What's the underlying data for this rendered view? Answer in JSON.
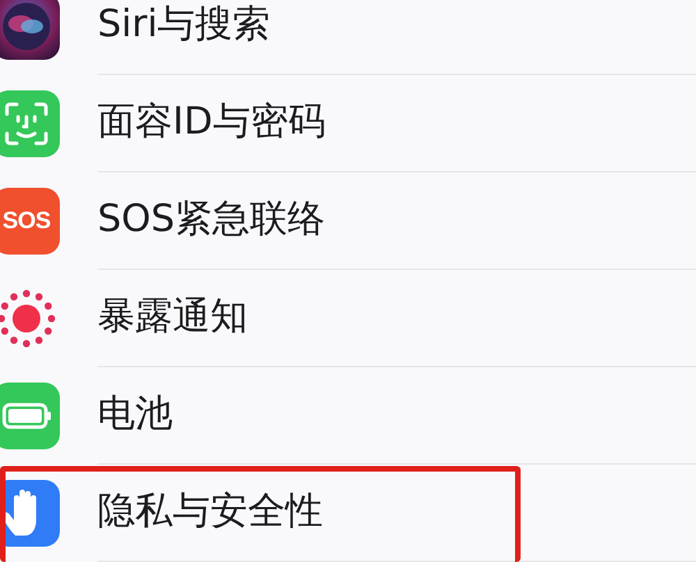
{
  "settings_items": [
    {
      "kind": "siri",
      "label": "Siri与搜索",
      "highlighted": false
    },
    {
      "kind": "faceid",
      "label": "面容ID与密码",
      "highlighted": false
    },
    {
      "kind": "sos",
      "icon_text": "SOS",
      "label": "SOS紧急联络",
      "highlighted": false
    },
    {
      "kind": "exposure",
      "label": "暴露通知",
      "highlighted": false
    },
    {
      "kind": "battery",
      "label": "电池",
      "highlighted": false
    },
    {
      "kind": "privacy",
      "label": "隐私与安全性",
      "highlighted": true
    }
  ]
}
